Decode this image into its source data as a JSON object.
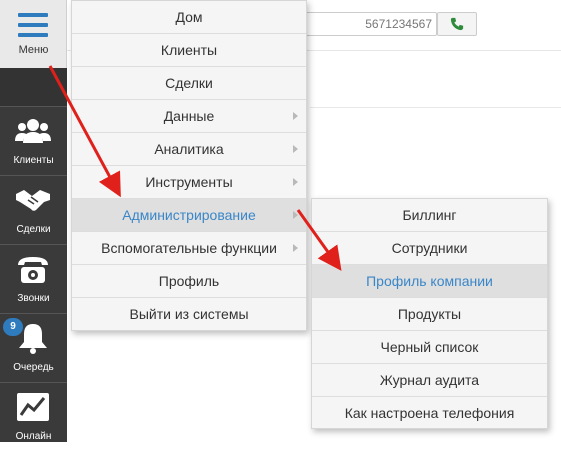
{
  "sidebar": {
    "menu_label": "Меню",
    "items": [
      {
        "label": "Клиенты",
        "icon": "users-icon"
      },
      {
        "label": "Сделки",
        "icon": "handshake-icon"
      },
      {
        "label": "Звонки",
        "icon": "phone-icon"
      },
      {
        "label": "Очередь",
        "icon": "bell-icon",
        "badge": "9"
      },
      {
        "label": "Онлайн",
        "icon": "chart-line-icon"
      }
    ]
  },
  "topbar": {
    "phone_value": "5671234567"
  },
  "main_menu": {
    "items": [
      {
        "label": "Дом"
      },
      {
        "label": "Клиенты"
      },
      {
        "label": "Сделки"
      },
      {
        "label": "Данные",
        "has_submenu": true
      },
      {
        "label": "Аналитика",
        "has_submenu": true
      },
      {
        "label": "Инструменты",
        "has_submenu": true
      },
      {
        "label": "Администрирование",
        "has_submenu": true,
        "active": true
      },
      {
        "label": "Вспомогательные функции",
        "has_submenu": true
      },
      {
        "label": "Профиль"
      },
      {
        "label": "Выйти из системы"
      }
    ]
  },
  "sub_menu": {
    "items": [
      {
        "label": "Биллинг"
      },
      {
        "label": "Сотрудники"
      },
      {
        "label": "Профиль компании",
        "active": true
      },
      {
        "label": "Продукты"
      },
      {
        "label": "Черный список"
      },
      {
        "label": "Журнал аудита"
      },
      {
        "label": "Как настроена телефония"
      }
    ]
  },
  "colors": {
    "sidebar_bg": "#3a3a3a",
    "accent": "#2e7bbd",
    "active_text": "#3a86c8",
    "arrow": "#e0201b",
    "call_green": "#2e8b3a"
  }
}
